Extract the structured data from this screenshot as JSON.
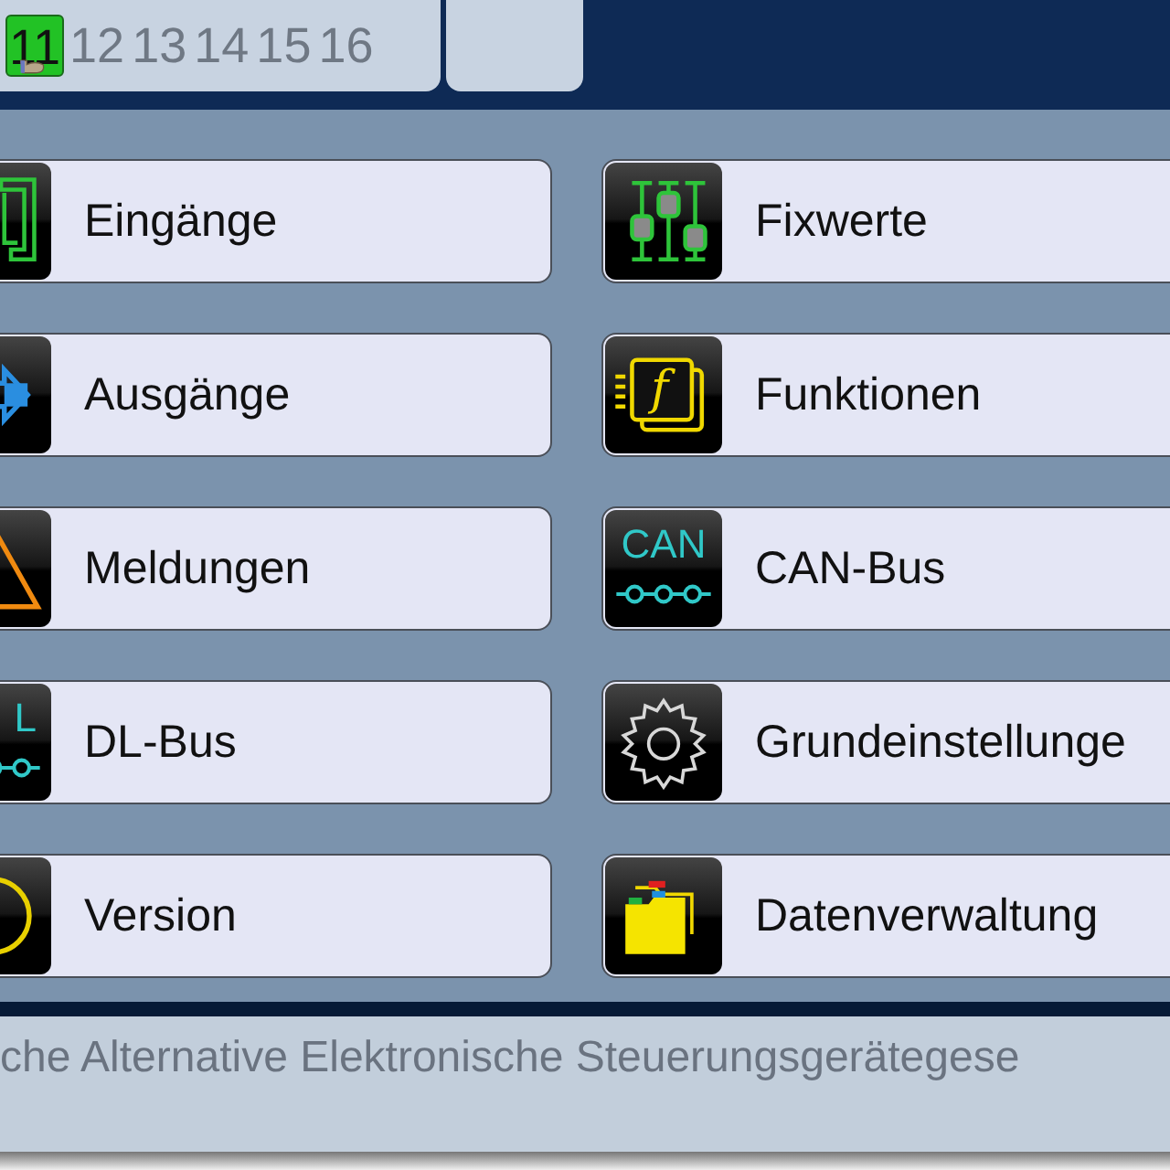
{
  "pages": [
    {
      "label": "11",
      "selected": true
    },
    {
      "label": "12",
      "selected": false
    },
    {
      "label": "13",
      "selected": false
    },
    {
      "label": "14",
      "selected": false
    },
    {
      "label": "15",
      "selected": false
    },
    {
      "label": "16",
      "selected": false
    }
  ],
  "menu": [
    {
      "label": "Eingänge",
      "kind": "inputs"
    },
    {
      "label": "Fixwerte",
      "kind": "fixed"
    },
    {
      "label": "Ausgänge",
      "kind": "outputs"
    },
    {
      "label": "Funktionen",
      "kind": "functions",
      "icon_text": "f"
    },
    {
      "label": "Meldungen",
      "kind": "messages"
    },
    {
      "label": "CAN-Bus",
      "kind": "bus",
      "icon_text": "CAN"
    },
    {
      "label": "DL-Bus",
      "kind": "bus",
      "icon_text": "L"
    },
    {
      "label": "Grundeinstellunge",
      "kind": "settings"
    },
    {
      "label": "Version",
      "kind": "version"
    },
    {
      "label": "Datenverwaltung",
      "kind": "data"
    }
  ],
  "footer": "che Alternative Elektronische Steuerungsgerätegese"
}
